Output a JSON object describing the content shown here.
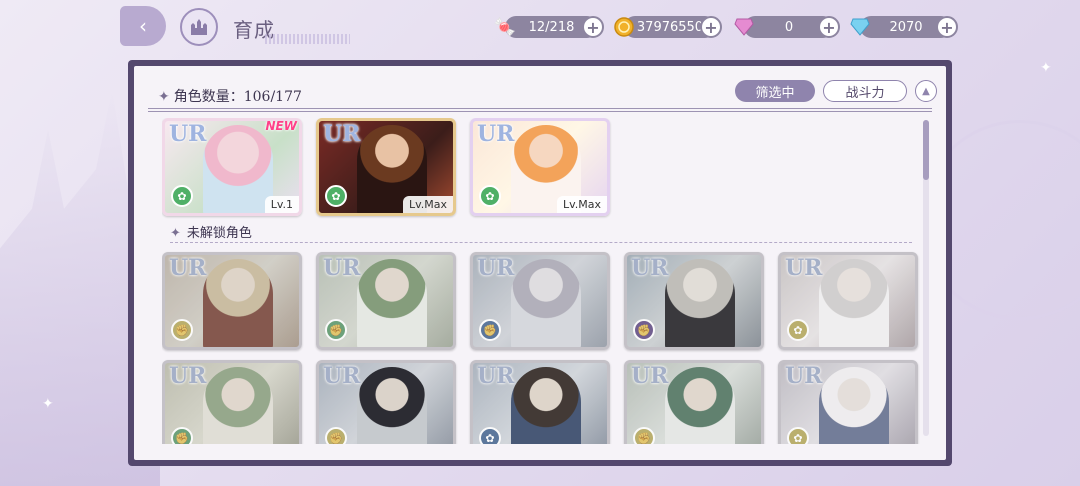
{
  "header": {
    "title": "育成",
    "resources": [
      {
        "name": "candy",
        "icon": "candy-icon",
        "value": "12/218"
      },
      {
        "name": "coin",
        "icon": "coin-icon",
        "value": "37976550"
      },
      {
        "name": "pink-gem",
        "icon": "pink-diamond-icon",
        "value": "0"
      },
      {
        "name": "blue-gem",
        "icon": "blue-diamond-icon",
        "value": "2070"
      }
    ]
  },
  "panel": {
    "count_label": "角色数量：106/177",
    "filter_label": "筛选中",
    "sort_label": "战斗力",
    "locked_header": "未解锁角色"
  },
  "owned": [
    {
      "rarity": "UR",
      "level": "Lv.1",
      "new": "NEW",
      "attr": "green"
    },
    {
      "rarity": "UR",
      "level": "Lv.Max",
      "attr": "green"
    },
    {
      "rarity": "UR",
      "level": "Lv.Max",
      "attr": "green"
    }
  ],
  "locked": [
    {
      "rarity": "UR",
      "attr": "yellow"
    },
    {
      "rarity": "UR",
      "attr": "green"
    },
    {
      "rarity": "UR",
      "attr": "blue"
    },
    {
      "rarity": "UR",
      "attr": "purple"
    },
    {
      "rarity": "UR",
      "attr": "yellow"
    },
    {
      "rarity": "UR",
      "attr": "green"
    },
    {
      "rarity": "UR",
      "attr": "yellow"
    },
    {
      "rarity": "UR",
      "attr": "blue"
    },
    {
      "rarity": "UR",
      "attr": "yellow"
    },
    {
      "rarity": "UR",
      "attr": "yellow"
    }
  ],
  "colors": {
    "panel_border": "#54486e",
    "filter_active": "#8f84ad",
    "new_badge": "#ff3f89"
  }
}
